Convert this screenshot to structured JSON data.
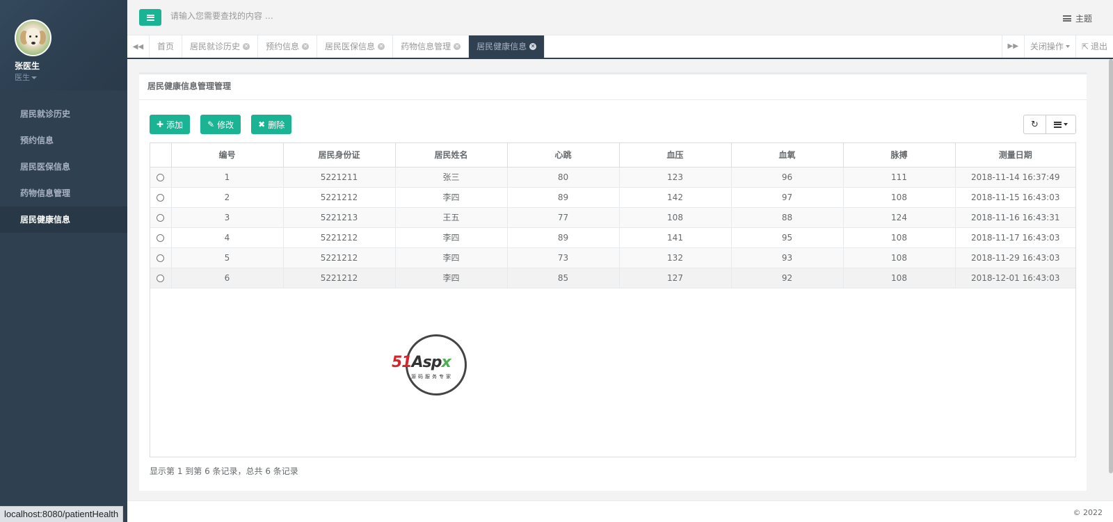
{
  "user": {
    "name": "张医生",
    "role": "医生"
  },
  "sidebar": {
    "items": [
      {
        "label": "居民就诊历史"
      },
      {
        "label": "预约信息"
      },
      {
        "label": "居民医保信息"
      },
      {
        "label": "药物信息管理"
      },
      {
        "label": "居民健康信息"
      }
    ],
    "active_index": 4
  },
  "topbar": {
    "search_placeholder": "请输入您需要查找的内容 …",
    "theme_label": "主题"
  },
  "tabs": [
    {
      "label": "首页",
      "closable": false
    },
    {
      "label": "居民就诊历史",
      "closable": true
    },
    {
      "label": "预约信息",
      "closable": true
    },
    {
      "label": "居民医保信息",
      "closable": true
    },
    {
      "label": "药物信息管理",
      "closable": true
    },
    {
      "label": "居民健康信息",
      "closable": true,
      "active": true
    }
  ],
  "tab_actions": {
    "close_ops": "关闭操作",
    "logout": "退出"
  },
  "panel": {
    "title": "居民健康信息管理管理",
    "buttons": {
      "add": "添加",
      "edit": "修改",
      "delete": "删除"
    }
  },
  "table": {
    "columns": [
      "编号",
      "居民身份证",
      "居民姓名",
      "心跳",
      "血压",
      "血氧",
      "脉搏",
      "测量日期"
    ],
    "rows": [
      [
        "1",
        "5221211",
        "张三",
        "80",
        "123",
        "96",
        "111",
        "2018-11-14 16:37:49"
      ],
      [
        "2",
        "5221212",
        "李四",
        "89",
        "142",
        "97",
        "108",
        "2018-11-15 16:43:03"
      ],
      [
        "3",
        "5221213",
        "王五",
        "77",
        "108",
        "88",
        "124",
        "2018-11-16 16:43:31"
      ],
      [
        "4",
        "5221212",
        "李四",
        "89",
        "141",
        "95",
        "108",
        "2018-11-17 16:43:03"
      ],
      [
        "5",
        "5221212",
        "李四",
        "73",
        "132",
        "93",
        "108",
        "2018-11-29 16:43:03"
      ],
      [
        "6",
        "5221212",
        "李四",
        "85",
        "127",
        "92",
        "108",
        "2018-12-01 16:43:03"
      ]
    ]
  },
  "pagination_info": "显示第 1 到第 6 条记录，总共 6 条记录",
  "watermark": {
    "brand_a": "51",
    "brand_b": "Asp",
    "brand_c": "x",
    "subtitle": "源码服务专家"
  },
  "footer": {
    "copyright": "© 2022"
  },
  "statusbar": {
    "url": "localhost:8080/patientHealth"
  },
  "colors": {
    "accent": "#1ab394",
    "sidebar_bg": "#2f4050",
    "sidebar_active": "#293846"
  }
}
